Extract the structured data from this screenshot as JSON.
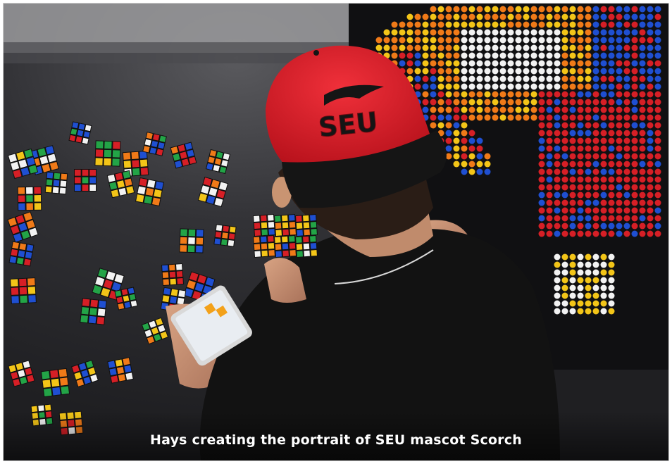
{
  "photo": {
    "subject": "person-assembling-rubiks-cube-mosaic",
    "colors": {
      "floor": "#2b2b2e",
      "cap_red": "#e3202c",
      "cap_black": "#151515",
      "shirt": "#121212",
      "skin": "#c99472",
      "hair": "#2a1d16",
      "cube_red": "#d61f26",
      "cube_blue": "#1f4fd1",
      "cube_yellow": "#f3c518",
      "cube_orange": "#f07a18",
      "cube_white": "#f2f2f2",
      "cube_green": "#23a447"
    },
    "cap_logo_text": "SEU"
  },
  "caption": {
    "text": "Hays creating the portrait of SEU mascot Scorch"
  }
}
